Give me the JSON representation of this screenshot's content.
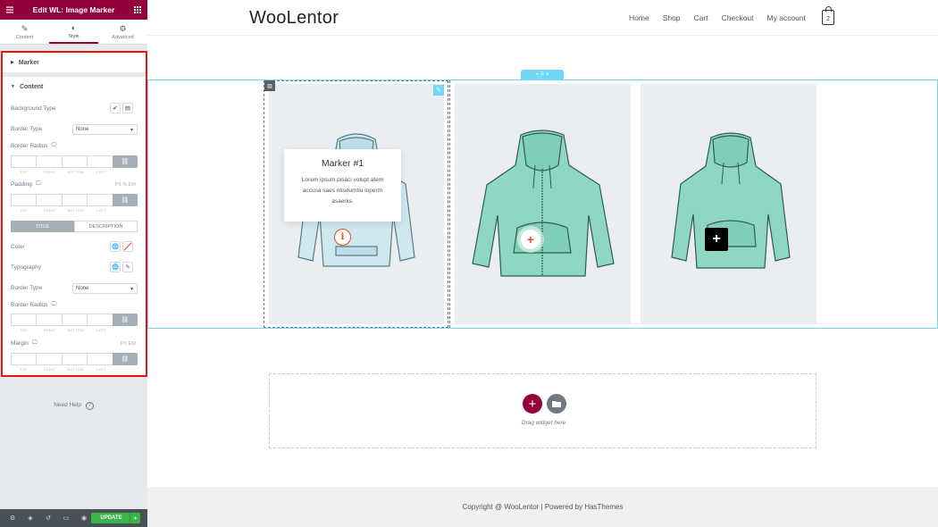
{
  "panel": {
    "title": "Edit WL: Image Marker",
    "tabs": [
      {
        "label": "Content",
        "icon": "pencil-icon"
      },
      {
        "label": "Style",
        "icon": "half-circle-icon"
      },
      {
        "label": "Advanced",
        "icon": "gear-icon"
      }
    ],
    "sections": {
      "marker": "Marker",
      "content": "Content"
    },
    "background_type": "Background Type",
    "border_type_label": "Border Type",
    "border_type_value": "None",
    "border_radius": "Border Radius",
    "padding": "Padding",
    "dim_labels": [
      "TOP",
      "RIGHT",
      "BOTTOM",
      "LEFT"
    ],
    "units": "PX  %  EM",
    "units_px_em": "PX  EM",
    "toggle": {
      "title": "TITLE",
      "description": "DESCRIPTION"
    },
    "color": "Color",
    "typography": "Typography",
    "border_type_2_label": "Border Type",
    "border_type_2_value": "None",
    "border_radius_2": "Border Radius",
    "margin": "Margin",
    "need_help": "Need Help",
    "update": "UPDATE"
  },
  "site": {
    "logo": "WooLentor",
    "nav": [
      "Home",
      "Shop",
      "Cart",
      "Checkout",
      "My account"
    ],
    "cart_count": "2",
    "section_handle": "+  ⠿  ×",
    "marker": {
      "title": "Marker #1",
      "description": "Lorem ipsum pisaci volupt atem accusa saes ntisdumtiu loperm asaerks."
    },
    "drop_zone_text": "Drag widget here",
    "footer": "Copyright @ WooLentor | Powered by HasThemes"
  },
  "colors": {
    "brand": "#93003c",
    "update_green": "#39b54a",
    "selection_blue": "#71d7f7",
    "hoodie_blue": "#cfe8f0",
    "hoodie_green": "#8ed8c3",
    "marker_red": "#e34a26"
  }
}
